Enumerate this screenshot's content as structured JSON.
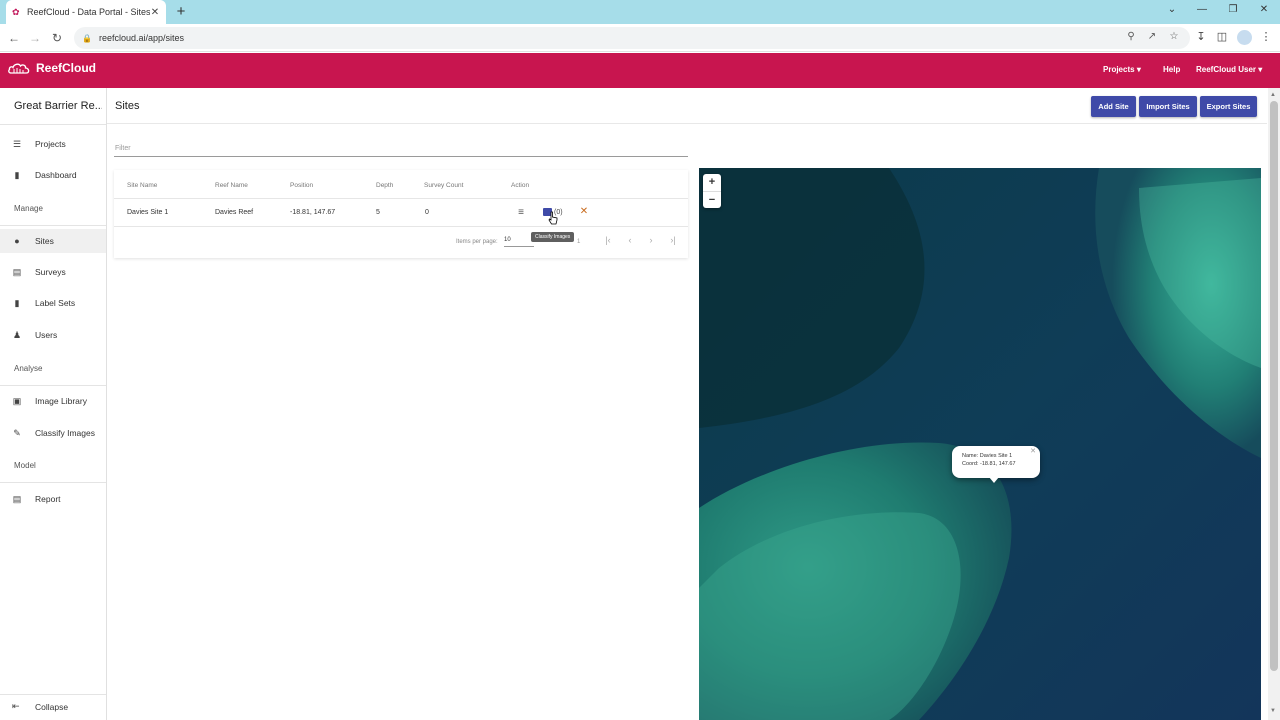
{
  "browser": {
    "tab_title": "ReefCloud - Data Portal - Sites",
    "url": "reefcloud.ai/app/sites"
  },
  "app": {
    "brand": "ReefCloud",
    "nav": {
      "projects": "Projects",
      "help": "Help",
      "user": "ReefCloud User"
    },
    "accent_color": "#c8154f",
    "button_color": "#3f4aa8"
  },
  "sidebar": {
    "project_name": "Great Barrier Re...",
    "items": {
      "projects": "Projects",
      "dashboard": "Dashboard",
      "manage": "Manage",
      "sites": "Sites",
      "surveys": "Surveys",
      "label_sets": "Label Sets",
      "users": "Users",
      "analyse": "Analyse",
      "image_library": "Image Library",
      "classify_images": "Classify Images",
      "model": "Model",
      "report": "Report"
    },
    "collapse": "Collapse"
  },
  "page": {
    "title": "Sites",
    "buttons": {
      "add_site": "Add Site",
      "import_sites": "Import Sites",
      "export_sites": "Export Sites"
    },
    "filter_placeholder": "Filter"
  },
  "table": {
    "columns": {
      "site_name": "Site Name",
      "reef_name": "Reef Name",
      "position": "Position",
      "depth": "Depth",
      "survey_count": "Survey Count",
      "action": "Action"
    },
    "rows": [
      {
        "site_name": "Davies Site 1",
        "reef_name": "Davies Reef",
        "position": "-18.81, 147.67",
        "depth": "5",
        "survey_count": "0",
        "image_count": "(0)"
      }
    ],
    "tooltip": "Classify Images",
    "pager": {
      "label": "Items per page:",
      "size": "10",
      "range": "1"
    }
  },
  "map": {
    "popup_name": "Name: Davies Site 1",
    "popup_coord": "Coord: -18.81, 147.67"
  }
}
